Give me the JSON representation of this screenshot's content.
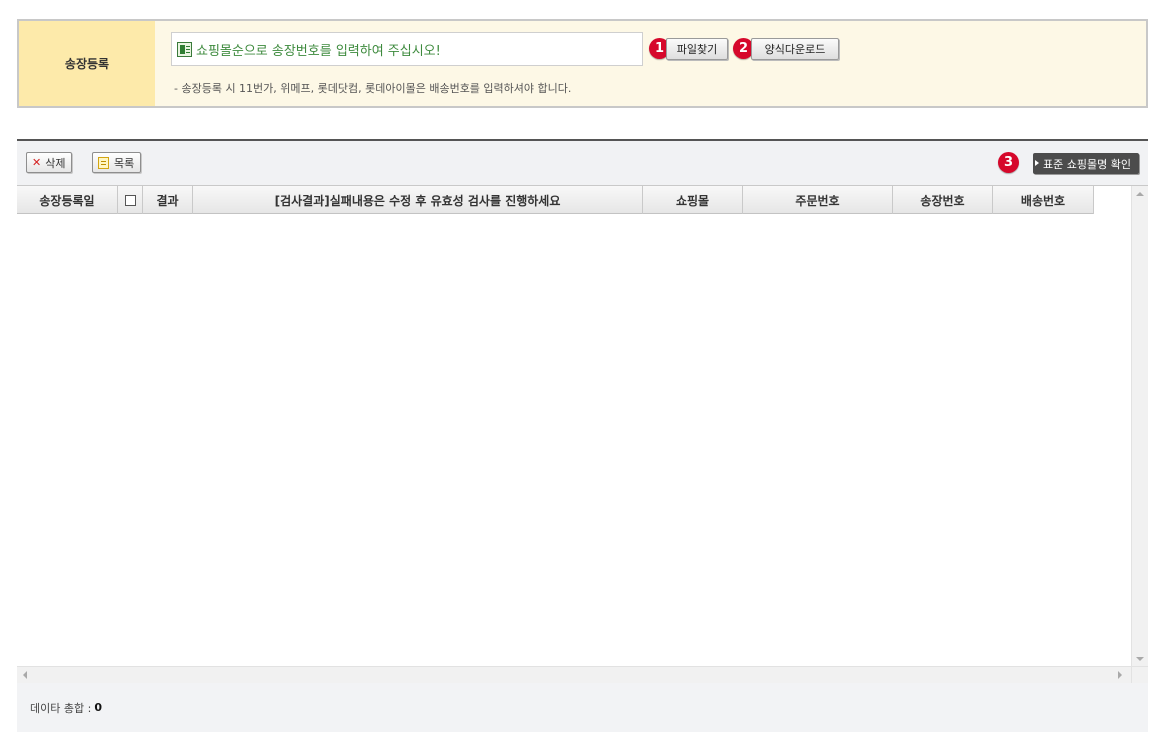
{
  "registration": {
    "label": "송장등록",
    "file_input_placeholder": "쇼핑몰순으로 송장번호를 입력하여 주십시오!",
    "file_button": "파일찾기",
    "download_button": "양식다운로드",
    "note": "- 송장등록 시 11번가, 위메프, 롯데닷컴, 롯데아이몰은 배송번호를 입력하셔야 합니다.",
    "badge1": "1",
    "badge2": "2"
  },
  "toolbar": {
    "delete_label": "삭제",
    "list_label": "목록",
    "standard_mall_label": "표준 쇼핑몰명 확인",
    "badge3": "3"
  },
  "table": {
    "columns": [
      "송장등록일",
      "",
      "결과",
      "[검사결과]실패내용은 수정 후 유효성 검사를 진행하세요",
      "쇼핑몰",
      "주문번호",
      "송장번호",
      "배송번호"
    ]
  },
  "footer": {
    "total_label": "데이타 총합 :",
    "total_value": "0"
  },
  "colors": {
    "label_bg": "#fdeaaa",
    "panel_bg": "#fdf8e6",
    "badge": "#d6082b",
    "dark_button": "#4c4c4c"
  }
}
